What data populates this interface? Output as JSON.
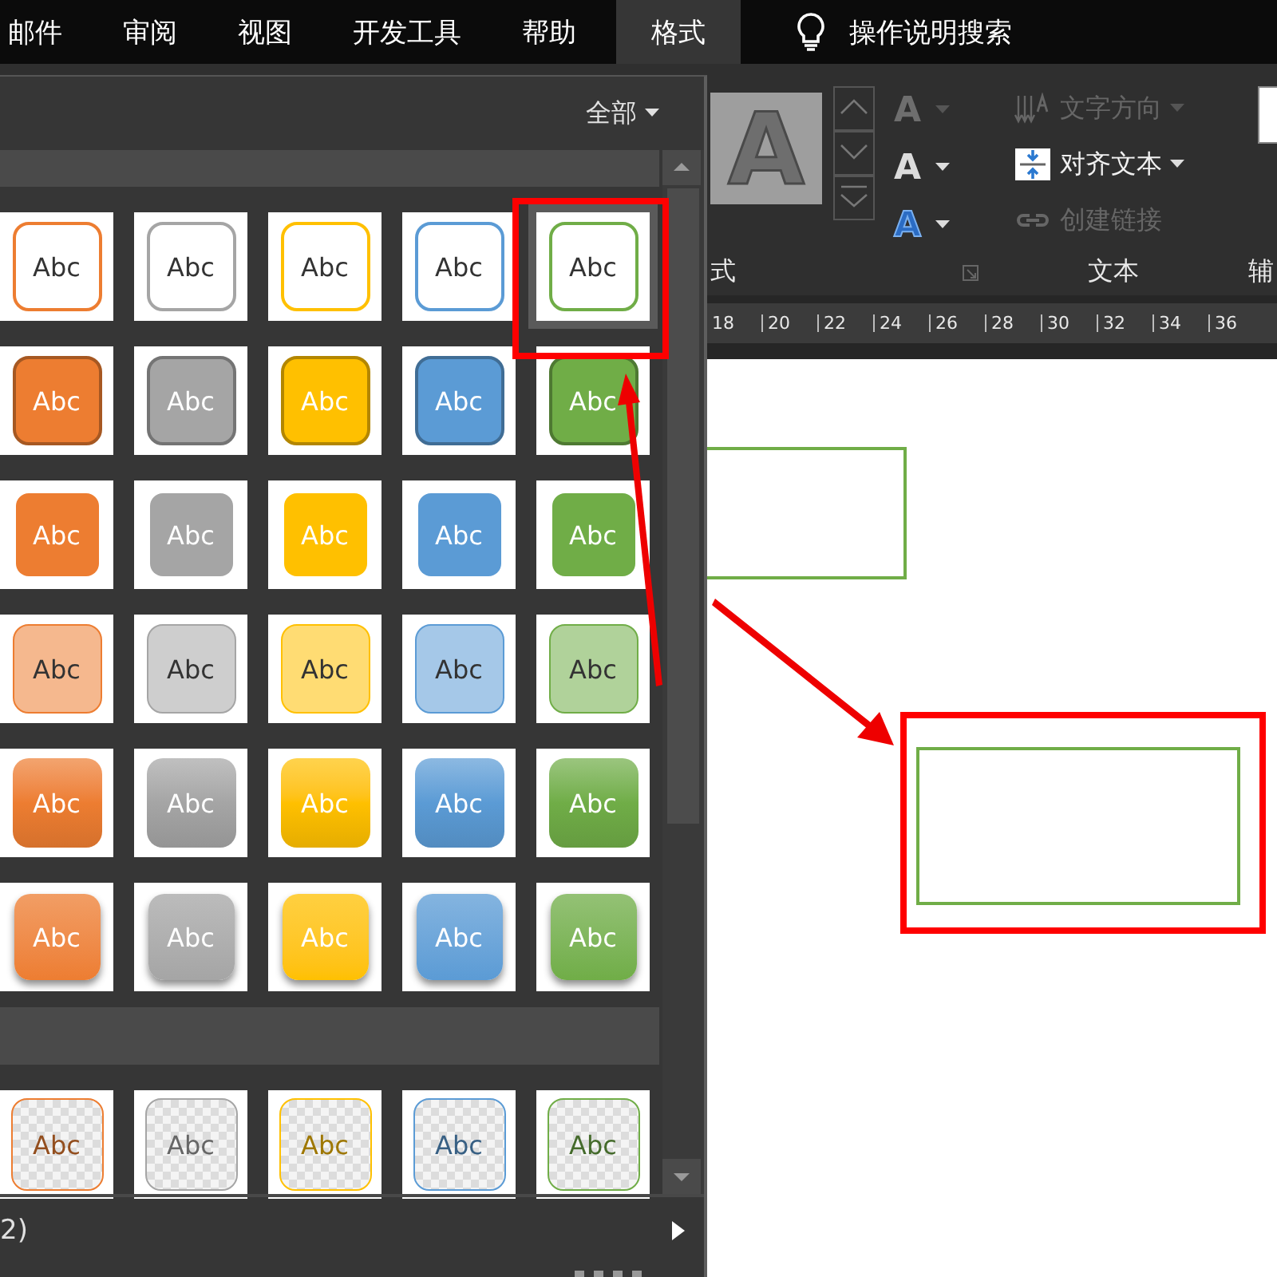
{
  "tabs": [
    {
      "label": "邮件",
      "selected": false
    },
    {
      "label": "审阅",
      "selected": false
    },
    {
      "label": "视图",
      "selected": false
    },
    {
      "label": "开发工具",
      "selected": false
    },
    {
      "label": "帮助",
      "selected": false
    },
    {
      "label": "格式",
      "selected": true
    }
  ],
  "search": {
    "label": "操作说明搜索"
  },
  "ribbon": {
    "preview": "A",
    "wordart": [
      {
        "glyph": "A",
        "kind": "fill",
        "disabled": true
      },
      {
        "glyph": "A",
        "kind": "outline",
        "disabled": false
      },
      {
        "glyph": "A",
        "kind": "effects",
        "disabled": false
      }
    ],
    "text_group": [
      {
        "label": "文字方向",
        "kind": "direction",
        "disabled": true
      },
      {
        "label": "对齐文本",
        "kind": "align",
        "disabled": false
      },
      {
        "label": "创建链接",
        "kind": "link",
        "disabled": true
      }
    ],
    "group_labels": [
      "式",
      "文本",
      "辅"
    ]
  },
  "ruler": [
    "18",
    "20",
    "22",
    "24",
    "26",
    "28",
    "30",
    "32",
    "34",
    "36"
  ],
  "gallery": {
    "filter": "全部",
    "footer": "2)",
    "sections": [
      {
        "rows": [
          {
            "kind": "outline",
            "tiles": [
              {
                "label": "Abc",
                "color": "#ed7d31",
                "selected": false
              },
              {
                "label": "Abc",
                "color": "#a5a5a5",
                "selected": false
              },
              {
                "label": "Abc",
                "color": "#ffc000",
                "selected": false
              },
              {
                "label": "Abc",
                "color": "#5b9bd5",
                "selected": false
              },
              {
                "label": "Abc",
                "color": "#70ad47",
                "selected": true
              }
            ]
          },
          {
            "kind": "bordered",
            "tiles": [
              {
                "label": "Abc",
                "color": "#ed7d31",
                "selected": false
              },
              {
                "label": "Abc",
                "color": "#a5a5a5",
                "selected": false
              },
              {
                "label": "Abc",
                "color": "#ffc000",
                "selected": false
              },
              {
                "label": "Abc",
                "color": "#5b9bd5",
                "selected": false
              },
              {
                "label": "Abc",
                "color": "#70ad47",
                "selected": false
              }
            ]
          },
          {
            "kind": "filled",
            "tiles": [
              {
                "label": "Abc",
                "color": "#ed7d31",
                "selected": false
              },
              {
                "label": "Abc",
                "color": "#a5a5a5",
                "selected": false
              },
              {
                "label": "Abc",
                "color": "#ffc000",
                "selected": false
              },
              {
                "label": "Abc",
                "color": "#5b9bd5",
                "selected": false
              },
              {
                "label": "Abc",
                "color": "#70ad47",
                "selected": false
              }
            ]
          },
          {
            "kind": "light",
            "tiles": [
              {
                "label": "Abc",
                "color": "#ed7d31",
                "selected": false
              },
              {
                "label": "Abc",
                "color": "#a5a5a5",
                "selected": false
              },
              {
                "label": "Abc",
                "color": "#ffc000",
                "selected": false
              },
              {
                "label": "Abc",
                "color": "#5b9bd5",
                "selected": false
              },
              {
                "label": "Abc",
                "color": "#70ad47",
                "selected": false
              }
            ]
          },
          {
            "kind": "gradient",
            "tiles": [
              {
                "label": "Abc",
                "color": "#ed7d31",
                "selected": false
              },
              {
                "label": "Abc",
                "color": "#a5a5a5",
                "selected": false
              },
              {
                "label": "Abc",
                "color": "#ffc000",
                "selected": false
              },
              {
                "label": "Abc",
                "color": "#5b9bd5",
                "selected": false
              },
              {
                "label": "Abc",
                "color": "#70ad47",
                "selected": false
              }
            ]
          },
          {
            "kind": "intense",
            "tiles": [
              {
                "label": "Abc",
                "color": "#ed7d31",
                "selected": false
              },
              {
                "label": "Abc",
                "color": "#a5a5a5",
                "selected": false
              },
              {
                "label": "Abc",
                "color": "#ffc000",
                "selected": false
              },
              {
                "label": "Abc",
                "color": "#5b9bd5",
                "selected": false
              },
              {
                "label": "Abc",
                "color": "#70ad47",
                "selected": false
              }
            ]
          }
        ]
      },
      {
        "rows": [
          {
            "kind": "transparent",
            "tiles": [
              {
                "label": "Abc",
                "color": "#ed7d31",
                "selected": false
              },
              {
                "label": "Abc",
                "color": "#a5a5a5",
                "selected": false
              },
              {
                "label": "Abc",
                "color": "#ffc000",
                "selected": false
              },
              {
                "label": "Abc",
                "color": "#5b9bd5",
                "selected": false
              },
              {
                "label": "Abc",
                "color": "#70ad47",
                "selected": false
              }
            ]
          }
        ]
      }
    ]
  }
}
